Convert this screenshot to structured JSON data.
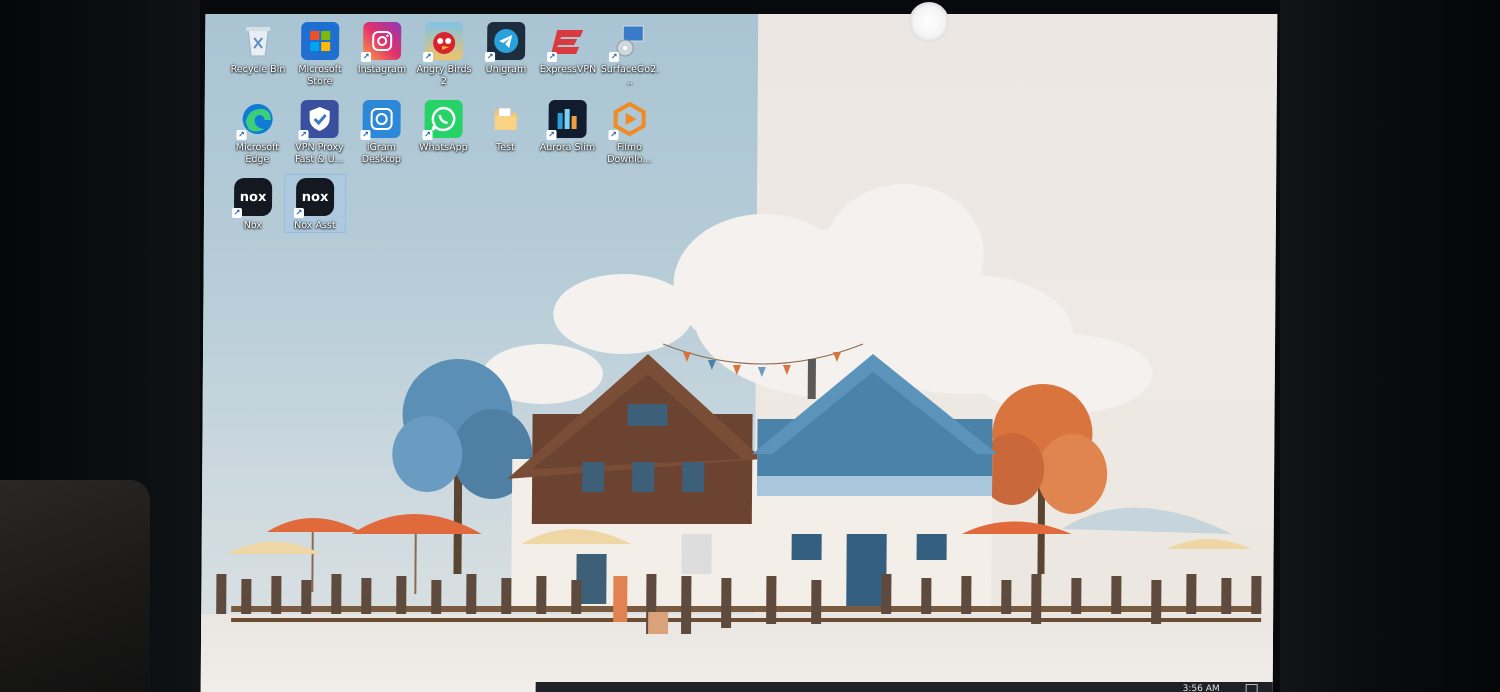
{
  "desktop": {
    "icons": [
      {
        "label": "Recycle Bin",
        "icon": "recycle-bin-icon"
      },
      {
        "label": "Microsoft Store",
        "icon": "microsoft-store-icon"
      },
      {
        "label": "Instagram",
        "icon": "instagram-icon"
      },
      {
        "label": "Angry Birds 2",
        "icon": "angry-birds-icon"
      },
      {
        "label": "Unigram",
        "icon": "telegram-icon"
      },
      {
        "label": "ExpressVPN",
        "icon": "expressvpn-icon"
      },
      {
        "label": "SurfaceGo2...",
        "icon": "computer-cd-icon"
      },
      {
        "label": "Microsoft Edge",
        "icon": "edge-icon"
      },
      {
        "label": "VPN Proxy Fast & U...",
        "icon": "vpn-shield-icon"
      },
      {
        "label": "iGram Desktop",
        "icon": "igram-icon"
      },
      {
        "label": "WhatsApp",
        "icon": "whatsapp-icon"
      },
      {
        "label": "Test",
        "icon": "folder-icon"
      },
      {
        "label": "Aurora Slim",
        "icon": "aurora-icon"
      },
      {
        "label": "Filmo Downlo...",
        "icon": "filmora-play-icon"
      },
      {
        "label": "Nox",
        "icon": "nox-icon"
      },
      {
        "label": "Nox Asst",
        "icon": "nox-assistant-icon"
      }
    ],
    "glyphs": {
      "store": "⊞",
      "telegram": "➤",
      "vpn": "✓",
      "igram": "◉",
      "whatsapp": "✆",
      "aurora": "▦",
      "filmora": "▶",
      "nox": "nox"
    }
  },
  "colors": {
    "sky_left": "#a9c4d3",
    "wall_right": "#ece7e3",
    "house_brown": "#6b4330",
    "house_blue": "#4b82aa",
    "tree_blue": "#5b8fb5",
    "tree_orange": "#d9743f",
    "umbrella_orange": "#e06a3c"
  },
  "taskbar": {
    "time": "3:56 AM"
  }
}
